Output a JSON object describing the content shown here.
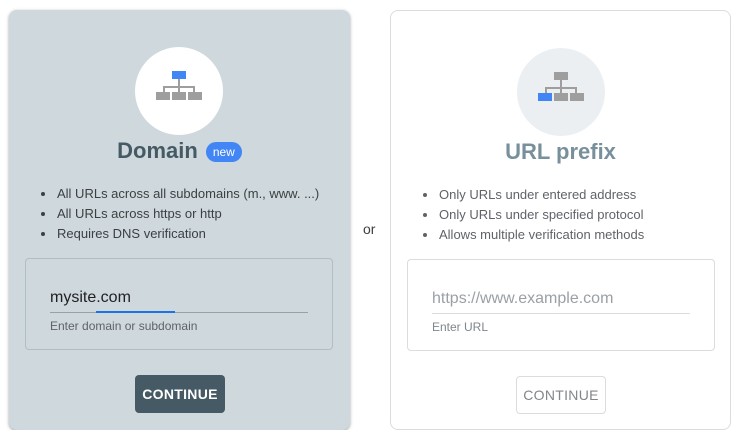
{
  "separator": "or",
  "domain": {
    "title": "Domain",
    "badge": "new",
    "features": [
      "All URLs across all subdomains (m., www. ...)",
      "All URLs across https or http",
      "Requires DNS verification"
    ],
    "input_value": "mysite.com",
    "input_helper": "Enter domain or subdomain",
    "button_label": "CONTINUE"
  },
  "url_prefix": {
    "title": "URL prefix",
    "features": [
      "Only URLs under entered address",
      "Only URLs under specified protocol",
      "Allows multiple verification methods"
    ],
    "input_placeholder": "https://www.example.com",
    "input_helper": "Enter URL",
    "button_label": "CONTINUE"
  },
  "colors": {
    "accent": "#4285f4",
    "domain_card_bg": "#cfd8dc",
    "primary_button": "#455a64"
  }
}
